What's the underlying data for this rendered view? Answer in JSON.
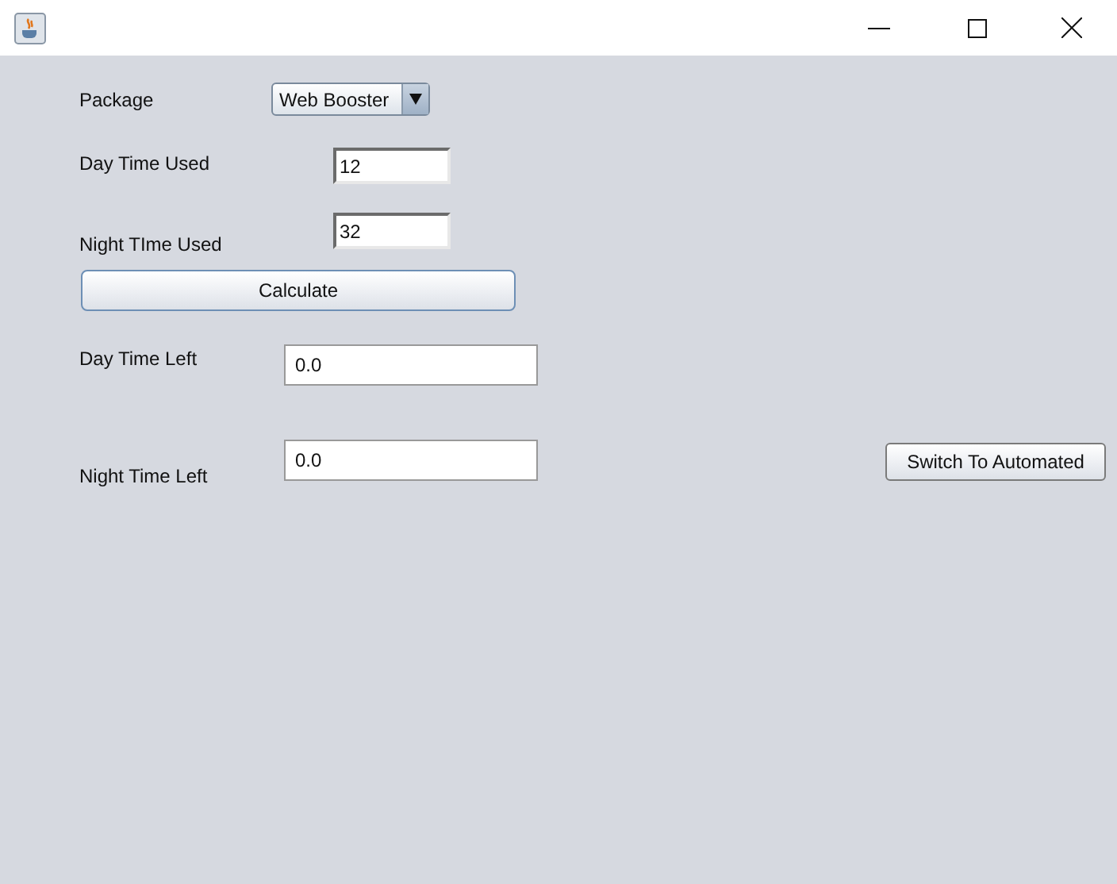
{
  "package": {
    "label": "Package",
    "value": "Web Booster"
  },
  "inputs": [
    {
      "label": "Day Time Used",
      "value": "12"
    },
    {
      "label": "Night TIme Used",
      "value": "32"
    }
  ],
  "calculate_button": "Calculate",
  "outputs": [
    {
      "label": "Day Time Left",
      "value": "0.0"
    },
    {
      "label": "Night Time Left",
      "value": "0.0"
    }
  ],
  "switch_button": "Switch To Automated"
}
